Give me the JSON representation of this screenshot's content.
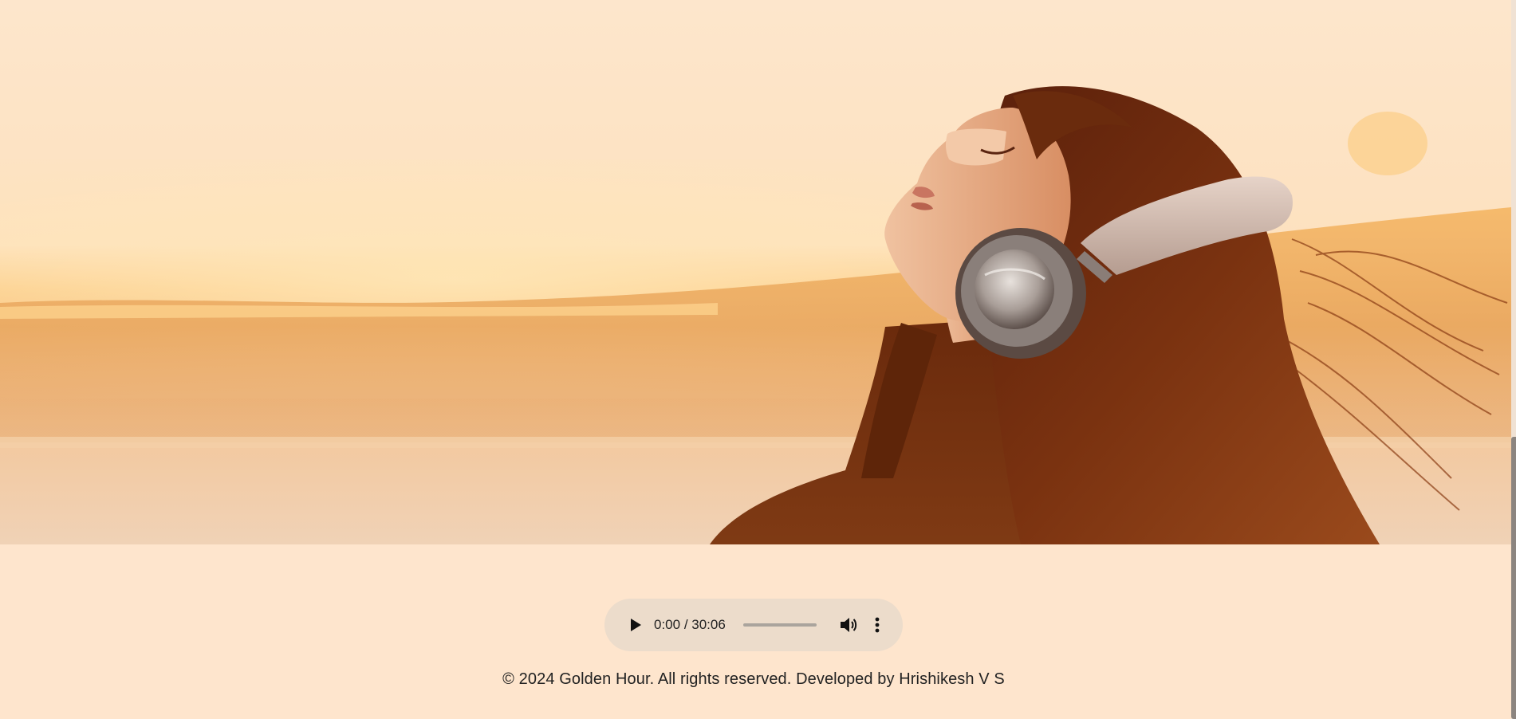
{
  "hero": {
    "image_alt": "Woman with headphones at sunset",
    "image_description_icon": "woman-headphones-sunset-photo"
  },
  "audio": {
    "current_time": "0:00",
    "separator": " / ",
    "duration": "30:06",
    "progress": 0,
    "play_icon": "play-icon",
    "volume_icon": "volume-icon",
    "menu_icon": "more-vertical-icon"
  },
  "footer": {
    "text": "© 2024 Golden Hour. All rights reserved. Developed by Hrishikesh V S"
  },
  "colors": {
    "background": "#fee5cd",
    "player_bg": "#ecdccb",
    "text": "#222222",
    "hair": "#6b2a0f",
    "sky": "#fde4c6"
  }
}
